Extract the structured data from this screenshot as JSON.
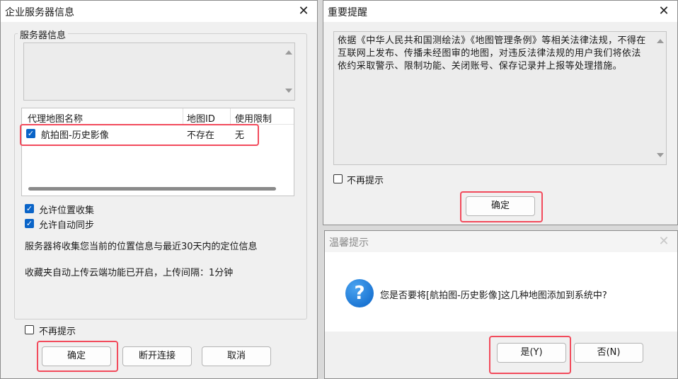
{
  "dlg1": {
    "title": "企业服务器信息",
    "group_title": "服务器信息",
    "table": {
      "headers": [
        "代理地图名称",
        "地图ID",
        "使用限制"
      ],
      "rows": [
        {
          "name": "航拍图-历史影像",
          "id": "不存在",
          "limit": "无",
          "checked": true
        }
      ]
    },
    "allow_location": "允许位置收集",
    "allow_sync": "允许自动同步",
    "info_line1": "服务器将收集您当前的位置信息与最近30天内的定位信息",
    "info_line2": "收藏夹自动上传云端功能已开启，上传间隔：1分钟",
    "dont_show": "不再提示",
    "ok": "确定",
    "disconnect": "断开连接",
    "cancel": "取消"
  },
  "dlg2": {
    "title": "重要提醒",
    "message": "依据《中华人民共和国测绘法》《地图管理条例》等相关法律法规，不得在互联网上发布、传播未经图审的地图，对违反法律法规的用户我们将依法依约采取警示、限制功能、关闭账号、保存记录并上报等处理措施。",
    "dont_show": "不再提示",
    "ok": "确定"
  },
  "dlg3": {
    "title": "温馨提示",
    "question": "您是否要将[航拍图-历史影像]这几种地图添加到系统中?",
    "yes": "是(Y)",
    "no": "否(N)"
  },
  "icons": {
    "close": "close-icon",
    "question": "question-icon",
    "check": "check-icon"
  },
  "colors": {
    "accent": "#0a64c8",
    "highlight": "#f24b5c"
  }
}
